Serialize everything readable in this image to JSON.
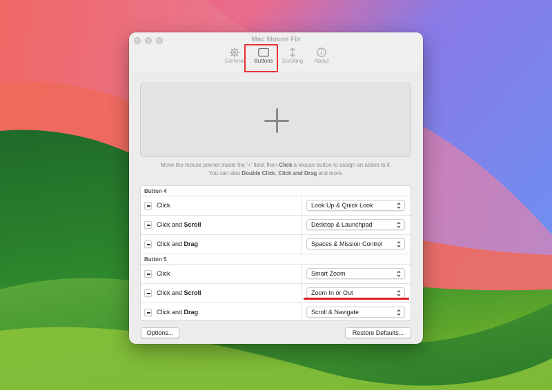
{
  "window": {
    "title": "Mac Mouse Fix"
  },
  "toolbar": {
    "tabs": [
      {
        "label": "General",
        "icon": "gear-icon"
      },
      {
        "label": "Buttons",
        "icon": "mouse-buttons-icon",
        "selected": true
      },
      {
        "label": "Scrolling",
        "icon": "vertical-arrows-icon"
      },
      {
        "label": "About",
        "icon": "info-icon"
      }
    ]
  },
  "dropzone": {
    "icon": "plus-icon",
    "hint_line1_a": "Move the mouse pointer inside the '+' field, then ",
    "hint_line1_b": "Click",
    "hint_line1_c": " a mouse button to assign an action to it.",
    "hint_line2_a": "You can also ",
    "hint_line2_b": "Double Click",
    "hint_line2_c": ", ",
    "hint_line2_d": "Click and Drag",
    "hint_line2_e": " and more."
  },
  "table": {
    "groups": [
      {
        "header": "Button 4",
        "rows": [
          {
            "trigger_plain": "Click",
            "trigger_bold": "",
            "action": "Look Up & Quick Look"
          },
          {
            "trigger_plain": "Click and ",
            "trigger_bold": "Scroll",
            "action": "Desktop & Launchpad"
          },
          {
            "trigger_plain": "Click and ",
            "trigger_bold": "Drag",
            "action": "Spaces & Mission Control"
          }
        ]
      },
      {
        "header": "Button 5",
        "rows": [
          {
            "trigger_plain": "Click",
            "trigger_bold": "",
            "action": "Smart Zoom"
          },
          {
            "trigger_plain": "Click and ",
            "trigger_bold": "Scroll",
            "action": "Zoom In or Out"
          },
          {
            "trigger_plain": "Click and ",
            "trigger_bold": "Drag",
            "action": "Scroll & Navigate"
          }
        ]
      }
    ]
  },
  "footer": {
    "options_label": "Options...",
    "restore_label": "Restore Defaults..."
  },
  "colors": {
    "highlight": "#e53232",
    "window_bg": "#ececec"
  }
}
